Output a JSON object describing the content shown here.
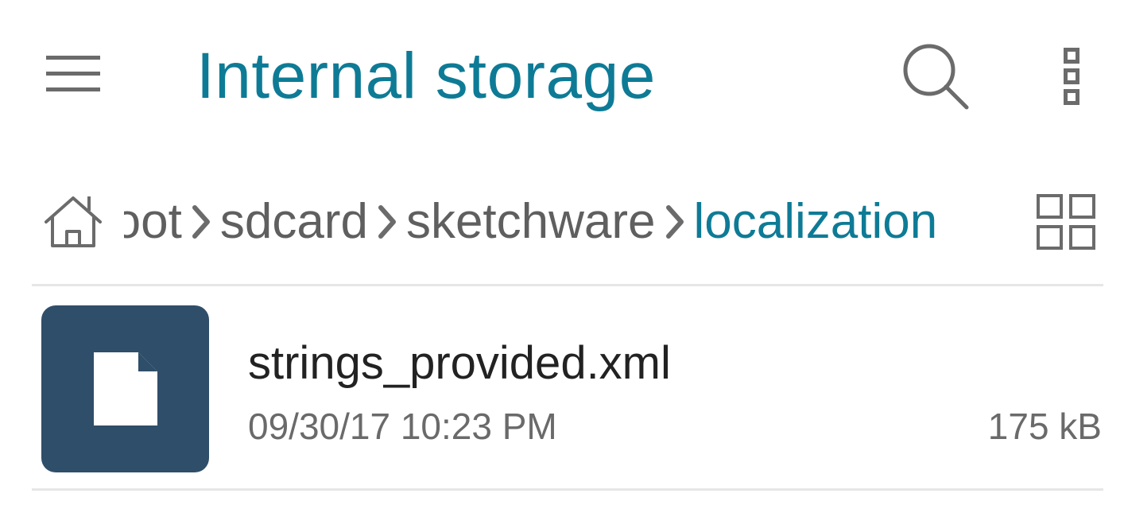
{
  "appbar": {
    "title": "Internal storage",
    "menu_icon": "hamburger-menu-icon",
    "search_icon": "search-icon",
    "overflow_icon": "more-vertical-icon"
  },
  "breadcrumb": {
    "home_icon": "home-icon",
    "items": [
      {
        "label": "root"
      },
      {
        "label": "sdcard"
      },
      {
        "label": "sketchware"
      },
      {
        "label": "localization"
      }
    ],
    "separator_icon": "chevron-right-icon",
    "view_toggle_icon": "grid-view-icon"
  },
  "files": [
    {
      "name": "strings_provided.xml",
      "date": "09/30/17 10:23 PM",
      "size": "175 kB",
      "icon": "file-icon"
    }
  ],
  "colors": {
    "accent": "#0e7b96",
    "thumb": "#2f4e69",
    "icon_gray": "#6b6b6b",
    "divider": "#e6e6e6"
  }
}
